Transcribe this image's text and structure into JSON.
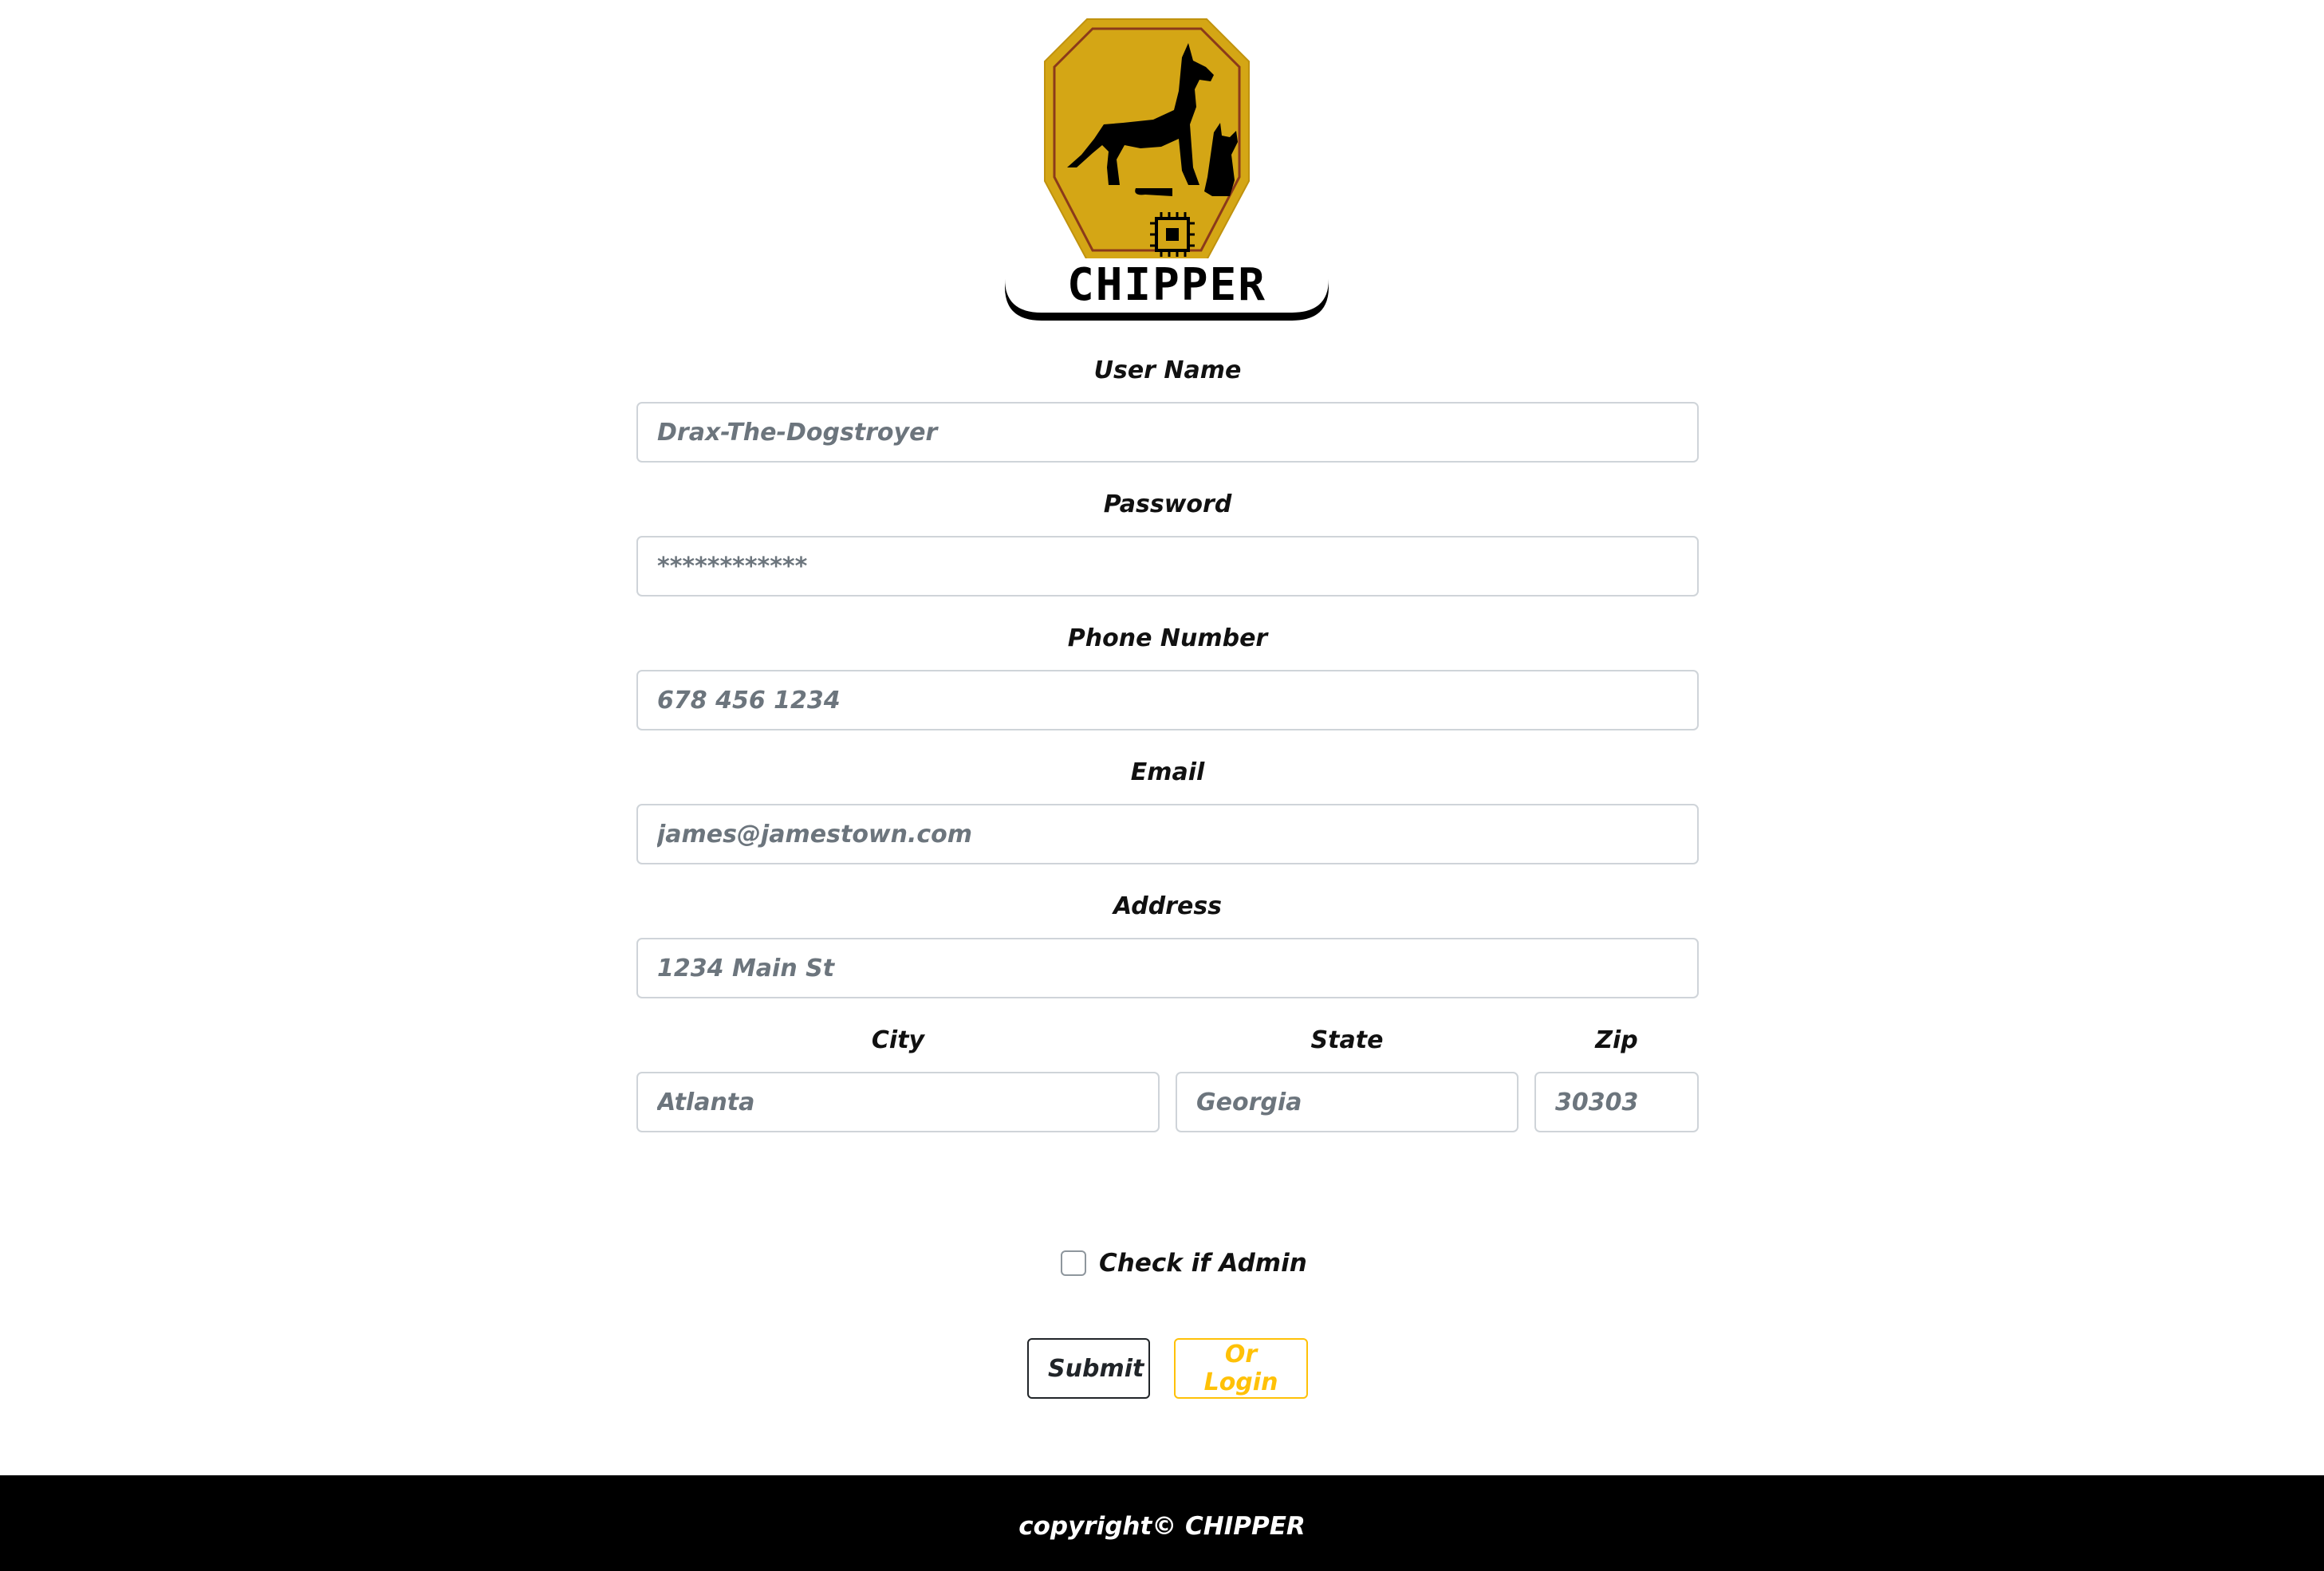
{
  "brand": {
    "name": "CHIPPER",
    "logo_colors": {
      "badge": "#d4a615",
      "badge_border": "#8b3a1a",
      "silhouette": "#000000"
    }
  },
  "form": {
    "username": {
      "label": "User Name",
      "placeholder": "Drax-The-Dogstroyer"
    },
    "password": {
      "label": "Password",
      "placeholder": "************"
    },
    "phone": {
      "label": "Phone Number",
      "placeholder": "678 456 1234"
    },
    "email": {
      "label": "Email",
      "placeholder": "james@jamestown.com"
    },
    "address": {
      "label": "Address",
      "placeholder": "1234 Main St"
    },
    "city": {
      "label": "City",
      "placeholder": "Atlanta"
    },
    "state": {
      "label": "State",
      "placeholder": "Georgia"
    },
    "zip": {
      "label": "Zip",
      "placeholder": "30303"
    },
    "admin_checkbox": {
      "label": "Check if Admin",
      "checked": false
    },
    "submit_label": "Submit",
    "login_label": "Or Login"
  },
  "colors": {
    "accent": "#ffc107",
    "dark": "#212529",
    "footer_bg": "#000000"
  },
  "footer": {
    "text": "copyright© CHIPPER"
  }
}
